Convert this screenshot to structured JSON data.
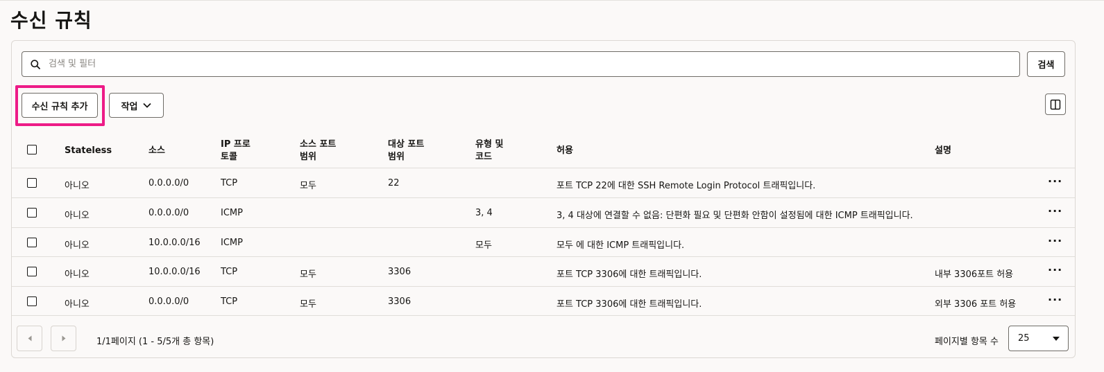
{
  "page": {
    "title": "수신 규칙"
  },
  "search": {
    "placeholder": "검색 및 필터",
    "button_label": "검색"
  },
  "toolbar": {
    "add_label": "수신 규칙 추가",
    "actions_label": "작업"
  },
  "table": {
    "headers": {
      "stateless": "Stateless",
      "source": "소스",
      "protocol_line1": "IP 프로",
      "protocol_line2": "토콜",
      "src_port_line1": "소스 포트",
      "src_port_line2": "범위",
      "dst_port_line1": "대상 포트",
      "dst_port_line2": "범위",
      "type_line1": "유형 및",
      "type_line2": "코드",
      "allow": "허용",
      "description": "설명"
    },
    "rows": [
      {
        "stateless": "아니오",
        "source": "0.0.0.0/0",
        "protocol": "TCP",
        "src_port": "모두",
        "dst_port": "22",
        "type_code": "",
        "allow": "포트 TCP 22에 대한 SSH Remote Login Protocol 트래픽입니다.",
        "description": ""
      },
      {
        "stateless": "아니오",
        "source": "0.0.0.0/0",
        "protocol": "ICMP",
        "src_port": "",
        "dst_port": "",
        "type_code": "3, 4",
        "allow": "3, 4 대상에 연결할 수 없음: 단편화 필요 및 단편화 안함이 설정됨에 대한 ICMP 트래픽입니다.",
        "description": ""
      },
      {
        "stateless": "아니오",
        "source": "10.0.0.0/16",
        "protocol": "ICMP",
        "src_port": "",
        "dst_port": "",
        "type_code": "모두",
        "allow": "모두 에 대한 ICMP 트래픽입니다.",
        "description": ""
      },
      {
        "stateless": "아니오",
        "source": "10.0.0.0/16",
        "protocol": "TCP",
        "src_port": "모두",
        "dst_port": "3306",
        "type_code": "",
        "allow": "포트 TCP 3306에 대한 트래픽입니다.",
        "description": "내부 3306포트 허용"
      },
      {
        "stateless": "아니오",
        "source": "0.0.0.0/0",
        "protocol": "TCP",
        "src_port": "모두",
        "dst_port": "3306",
        "type_code": "",
        "allow": "포트 TCP 3306에 대한 트래픽입니다.",
        "description": "외부 3306 포트 허용"
      }
    ],
    "row_menu": "···"
  },
  "pagination": {
    "summary": "1/1페이지 (1 - 5/5개 총 항목)",
    "per_page_label": "페이지별 항목 수",
    "per_page_value": "25"
  },
  "icons": {
    "search": "search-icon",
    "actions_chevron": "chevron-down-icon",
    "columns": "columns-icon",
    "prev": "chevron-left-icon",
    "next": "chevron-right-icon",
    "select_caret": "caret-down-icon"
  },
  "colors": {
    "highlight": "#ed1b87"
  }
}
